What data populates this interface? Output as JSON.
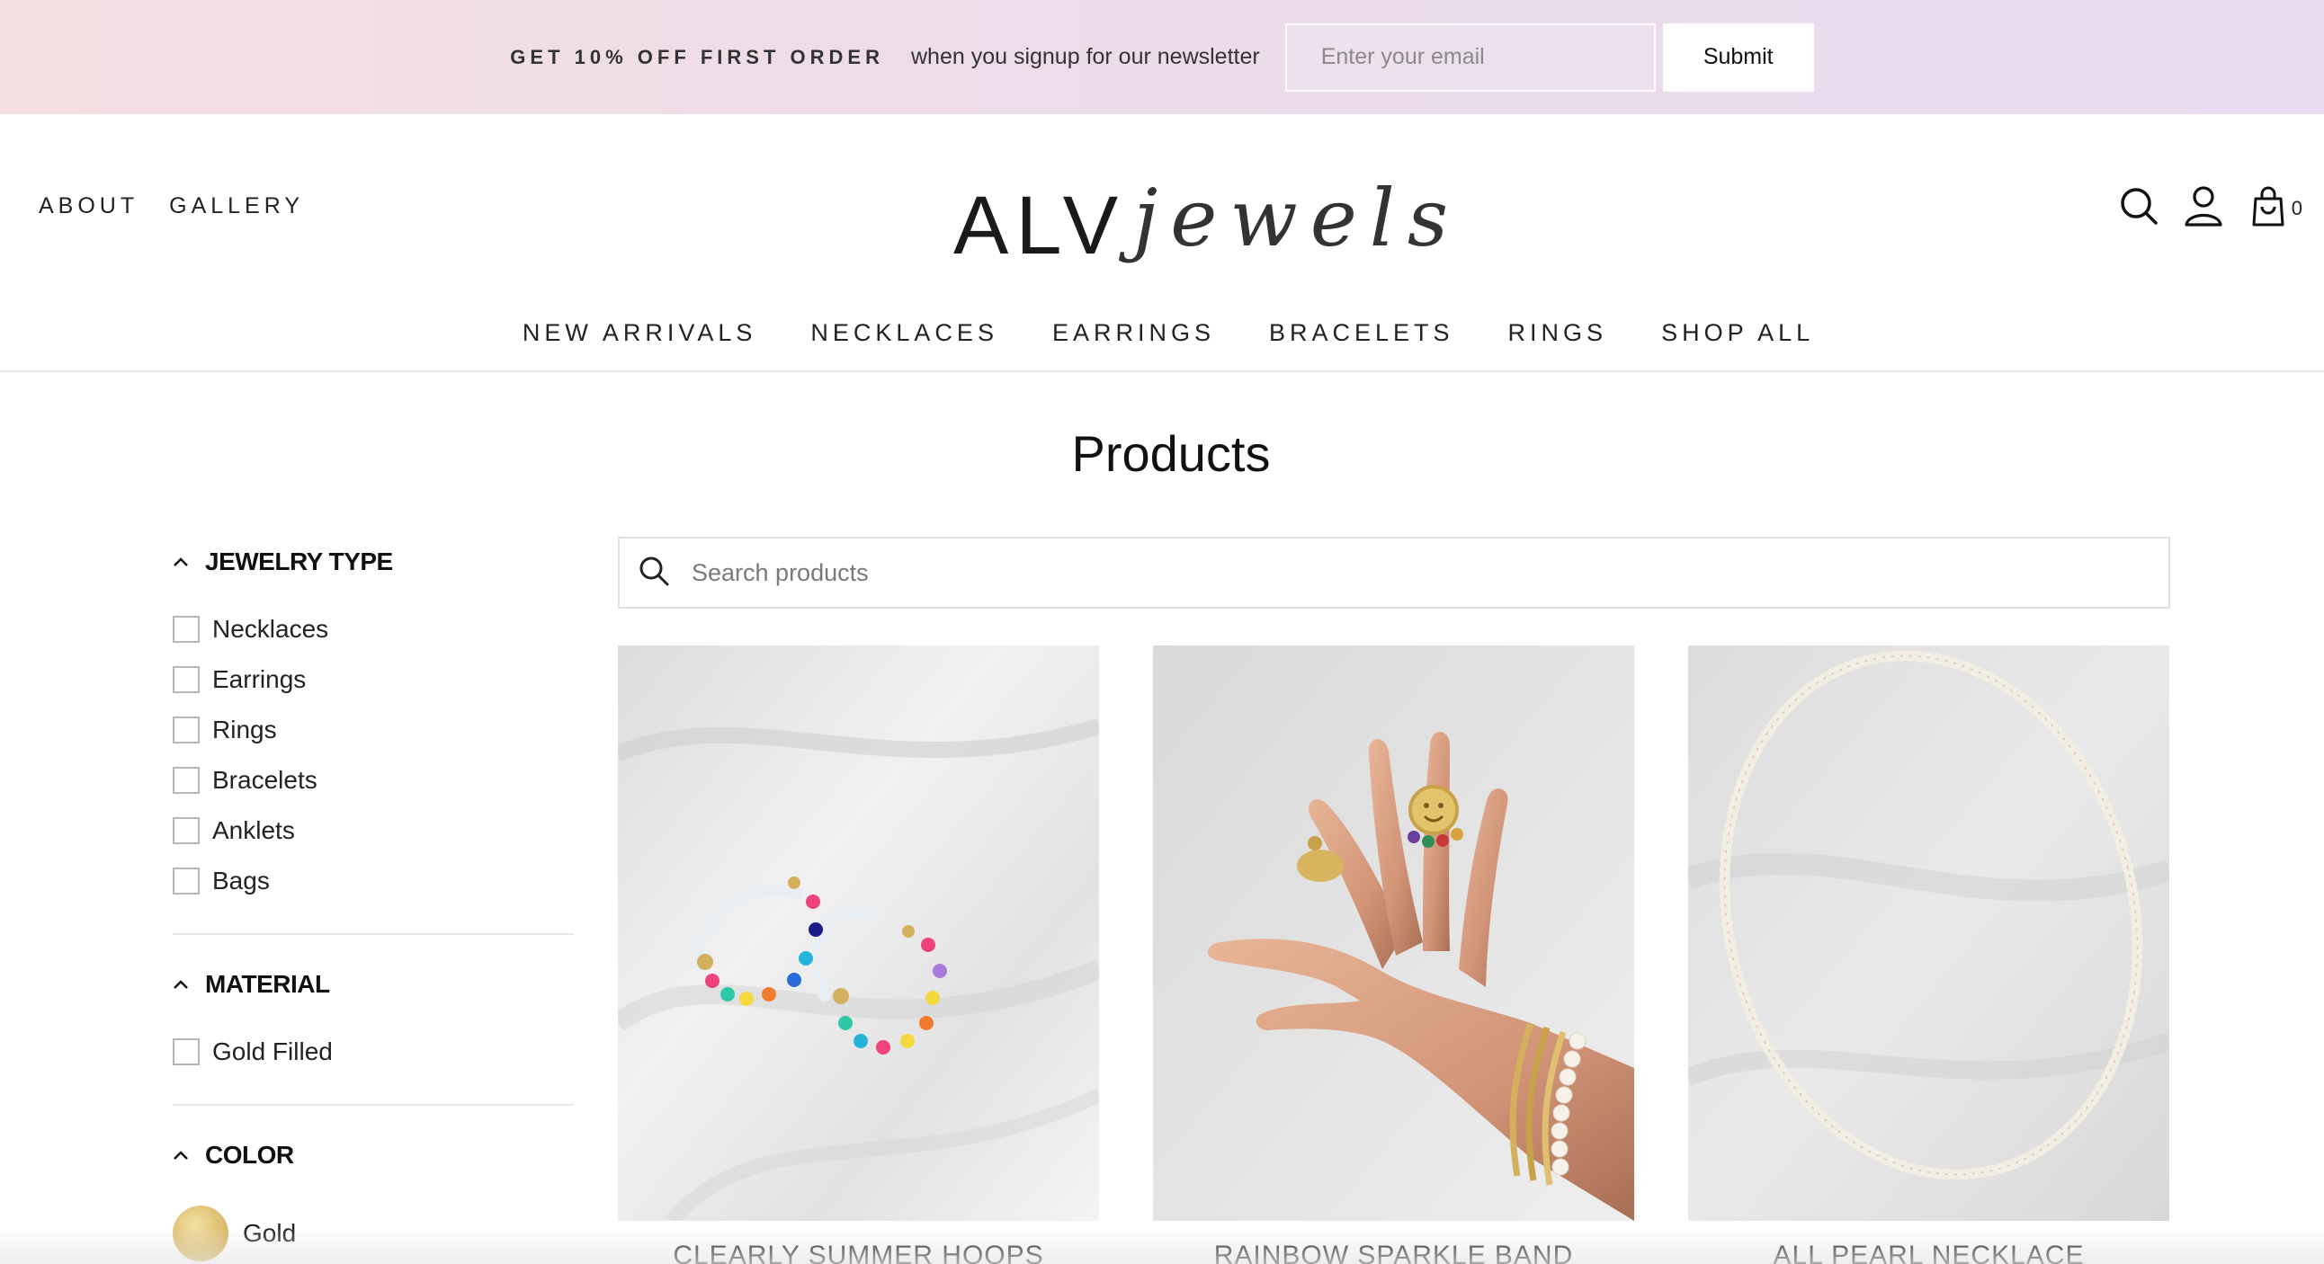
{
  "promo": {
    "headline": "GET 10% OFF FIRST ORDER",
    "text": "when you signup for our newsletter",
    "email_placeholder": "Enter your email",
    "submit_label": "Submit"
  },
  "header": {
    "left_links": [
      "ABOUT",
      "GALLERY"
    ],
    "logo_main": "ALV",
    "logo_script": "jewels",
    "cart_count": "0",
    "nav": [
      "NEW ARRIVALS",
      "NECKLACES",
      "EARRINGS",
      "BRACELETS",
      "RINGS",
      "SHOP ALL"
    ]
  },
  "page": {
    "title": "Products",
    "search_placeholder": "Search products"
  },
  "filters": {
    "jewelry_type": {
      "title": "JEWELRY TYPE",
      "items": [
        "Necklaces",
        "Earrings",
        "Rings",
        "Bracelets",
        "Anklets",
        "Bags"
      ]
    },
    "material": {
      "title": "MATERIAL",
      "items": [
        "Gold Filled"
      ]
    },
    "color": {
      "title": "COLOR",
      "items": [
        "Gold"
      ]
    }
  },
  "products": [
    {
      "name": "CLEARLY SUMMER HOOPS"
    },
    {
      "name": "RAINBOW SPARKLE BAND"
    },
    {
      "name": "ALL PEARL NECKLACE"
    }
  ],
  "colors": {
    "promo_start": "#f4dfe2",
    "promo_end": "#e9dcf0",
    "text": "#222222",
    "border": "#e6e6e6",
    "gold_swatch": "#d8b45f"
  }
}
